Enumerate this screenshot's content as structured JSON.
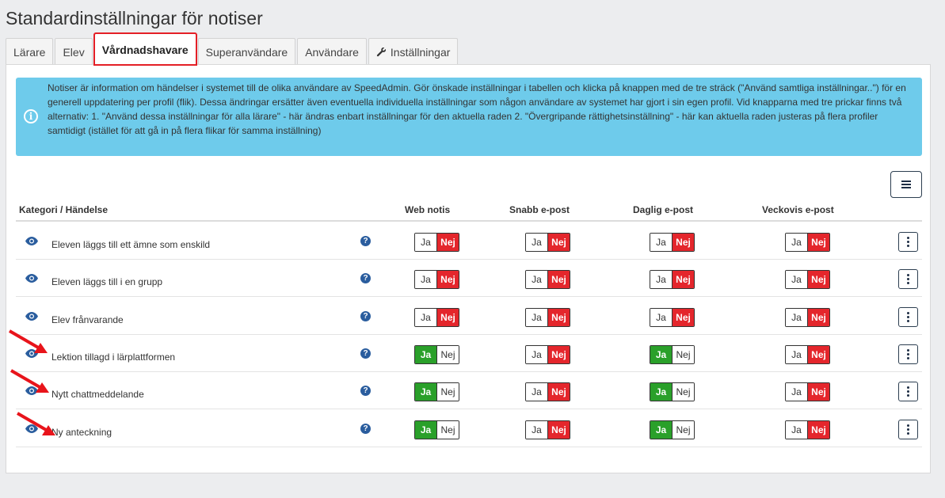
{
  "page": {
    "title": "Standardinställningar för notiser"
  },
  "tabs": [
    {
      "label": "Lärare",
      "active": false
    },
    {
      "label": "Elev",
      "active": false
    },
    {
      "label": "Vårdnadshavare",
      "active": true
    },
    {
      "label": "Superanvändare",
      "active": false
    },
    {
      "label": "Användare",
      "active": false
    },
    {
      "label": "Inställningar",
      "active": false,
      "icon": "wrench-icon"
    }
  ],
  "info": {
    "text": "Notiser är information om händelser i systemet till de olika användare av SpeedAdmin. Gör önskade inställningar i tabellen och klicka på knappen med de tre sträck (\"Använd samtliga inställningar..\") för en generell uppdatering per profil (flik). Dessa ändringar ersätter även eventuella individuella inställningar som någon användare av systemet har gjort i sin egen profil. Vid knapparna med tre prickar finns två alternativ: 1. \"Använd dessa inställningar för alla lärare\" - här ändras enbart inställningar för den aktuella raden 2. \"Övergripande rättighetsinställning\" - här kan aktuella raden justeras på flera profiler samtidigt (istället för att gå in på flera flikar för samma inställning)"
  },
  "table": {
    "columns": [
      "Kategori / Händelse",
      "Web notis",
      "Snabb e-post",
      "Daglig e-post",
      "Veckovis e-post"
    ],
    "toggle_labels": {
      "yes": "Ja",
      "no": "Nej"
    },
    "rows": [
      {
        "label": "Eleven läggs till ett ämne som enskild",
        "web": false,
        "snabb": false,
        "daglig": false,
        "veckovis": false
      },
      {
        "label": "Eleven läggs till i en grupp",
        "web": false,
        "snabb": false,
        "daglig": false,
        "veckovis": false
      },
      {
        "label": "Elev frånvarande",
        "web": false,
        "snabb": false,
        "daglig": false,
        "veckovis": false
      },
      {
        "label": "Lektion tillagd i lärplattformen",
        "web": true,
        "snabb": false,
        "daglig": true,
        "veckovis": false
      },
      {
        "label": "Nytt chattmeddelande",
        "web": true,
        "snabb": false,
        "daglig": true,
        "veckovis": false
      },
      {
        "label": "Ny anteckning",
        "web": true,
        "snabb": false,
        "daglig": true,
        "veckovis": false
      }
    ]
  },
  "colors": {
    "accent": "#e41f26",
    "on": "#2aa02a",
    "off": "#e4262c",
    "info_bg": "#6ecbeb"
  }
}
